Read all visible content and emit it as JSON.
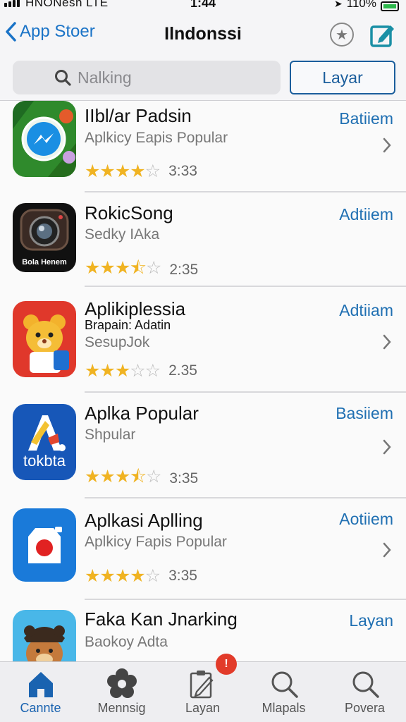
{
  "status_bar": {
    "carrier": "HNONesn LTE",
    "time": "1:44",
    "battery": "110%"
  },
  "nav": {
    "back_label": "App Stoer",
    "title": "Ilndonssi"
  },
  "search": {
    "placeholder": "Nalking",
    "button_label": "Layar"
  },
  "apps": [
    {
      "name": "IIbl/ar Padsin",
      "subtitle": "Aplkicy Eapis Popular",
      "extra": "",
      "rating": 4,
      "rating_text": "3:33",
      "action": "Batiiem",
      "icon": "messenger-leaf-icon",
      "icon_label": ""
    },
    {
      "name": "RokicSong",
      "subtitle": "Sedky IAka",
      "extra": "",
      "rating": 3.5,
      "rating_text": "2:35",
      "action": "Adtiiem",
      "icon": "camera-icon",
      "icon_label": "Bola Henem"
    },
    {
      "name": "Aplikiplessia",
      "subtitle": "SesupJok",
      "extra": "Brapain: Adatin",
      "rating": 3,
      "rating_text": "2.35",
      "action": "Adtiiam",
      "icon": "bear-icon",
      "icon_label": ""
    },
    {
      "name": "Aplka Popular",
      "subtitle": "Shpular",
      "extra": "",
      "rating": 3.5,
      "rating_text": "3:35",
      "action": "Basiiem",
      "icon": "tokbta-logo-icon",
      "icon_label": "tokbta"
    },
    {
      "name": "Aplkasi Aplling",
      "subtitle": "Aplkicy Fapis Popular",
      "extra": "",
      "rating": 4,
      "rating_text": "3:35",
      "action": "Aotiiem",
      "icon": "camera-dot-icon",
      "icon_label": ""
    },
    {
      "name": "Faka Kan Jnarking",
      "subtitle": "Baokoy Adta",
      "extra": "",
      "rating": 0,
      "rating_text": "",
      "action": "Layan",
      "icon": "bear-cap-icon",
      "icon_label": ""
    }
  ],
  "tabs": [
    {
      "label": "Cannte",
      "icon": "home-icon",
      "active": true
    },
    {
      "label": "Mennsig",
      "icon": "flower-icon",
      "active": false
    },
    {
      "label": "Layan",
      "icon": "edit-icon",
      "active": false,
      "badge": "!"
    },
    {
      "label": "Mlapals",
      "icon": "search-icon",
      "active": false
    },
    {
      "label": "Povera",
      "icon": "search-icon",
      "active": false
    }
  ],
  "colors": {
    "accent": "#1a73c7",
    "star": "#f0b322",
    "badge": "#e23b2a"
  }
}
